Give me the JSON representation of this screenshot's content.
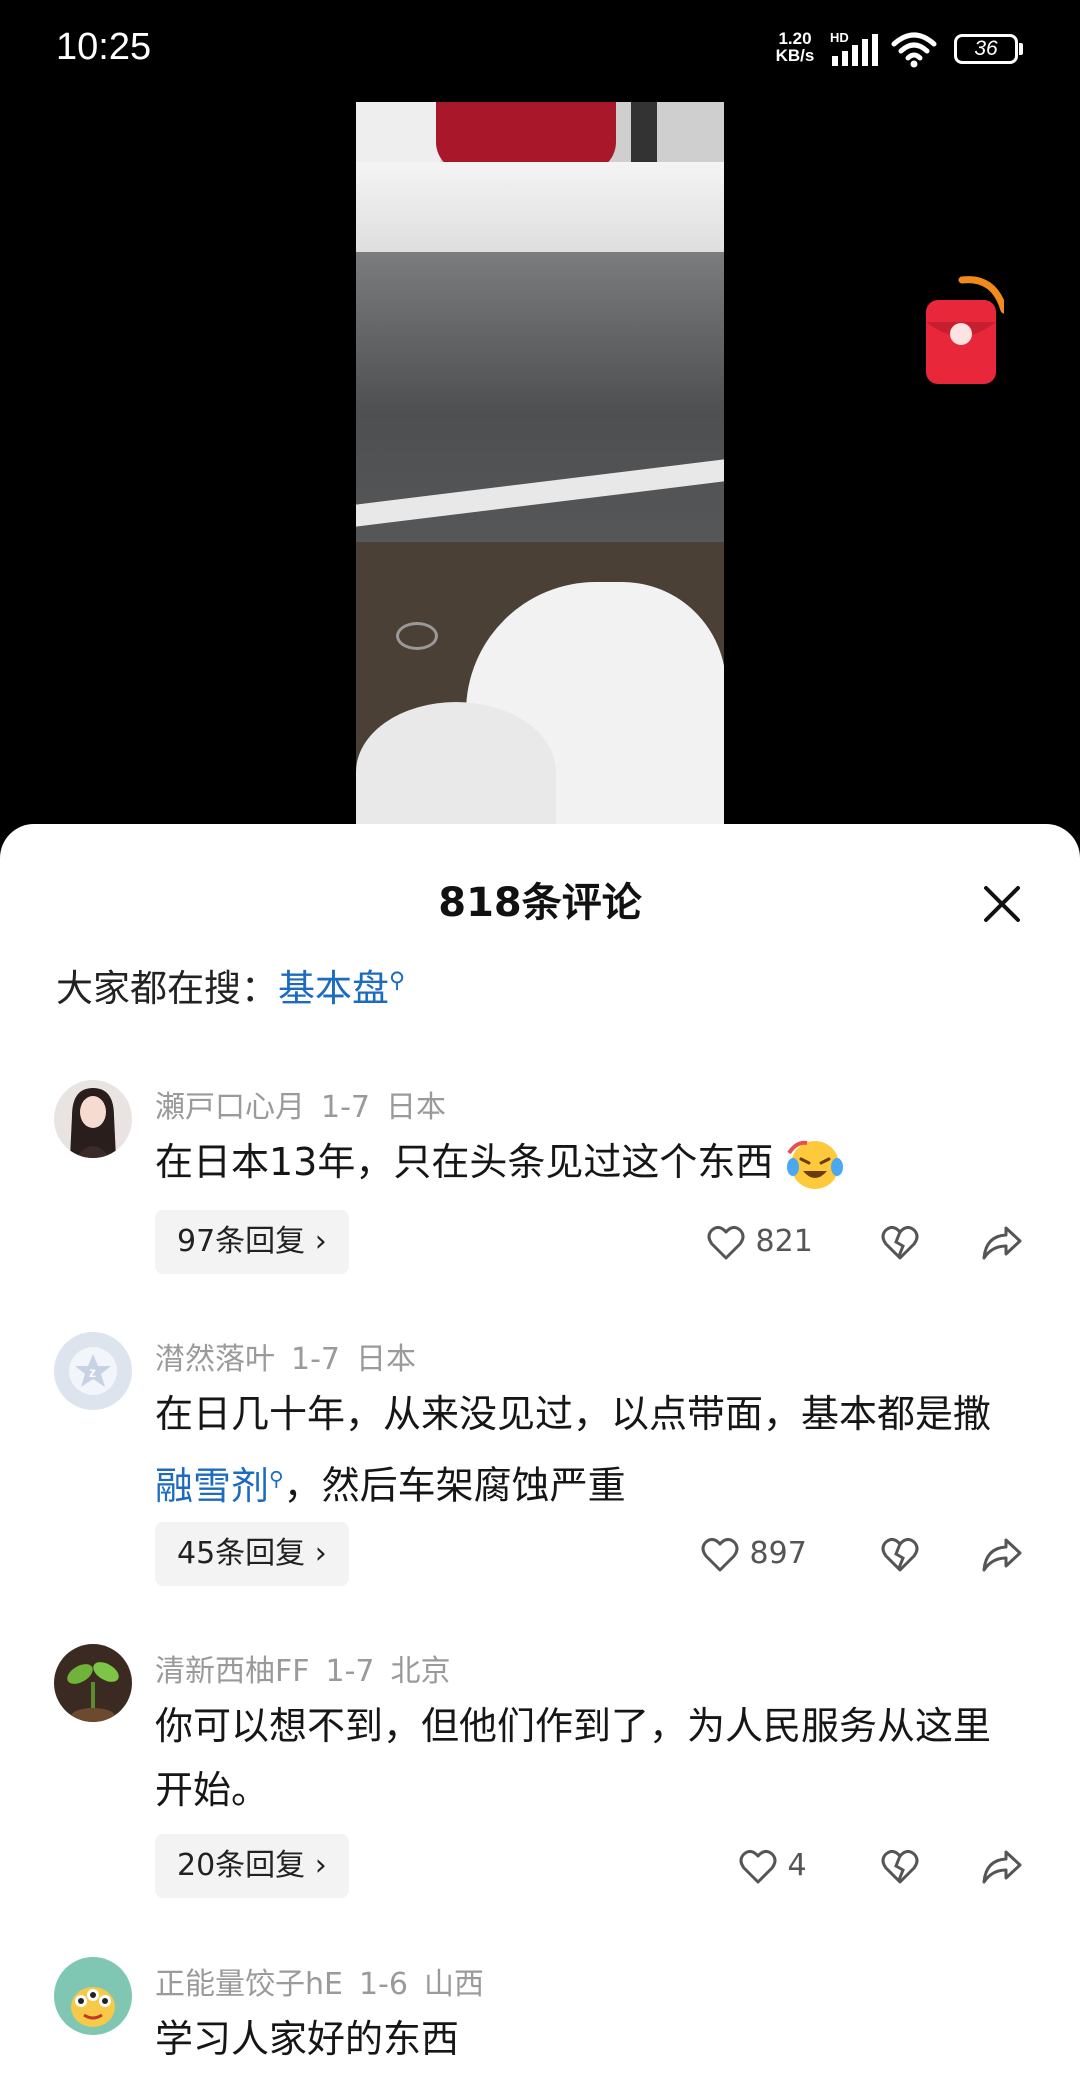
{
  "status_bar": {
    "time": "10:25",
    "net_speed_value": "1.20",
    "net_speed_unit": "KB/s",
    "network_label": "HD",
    "battery": "36"
  },
  "comments_panel": {
    "title": "818条评论",
    "search_prefix": "大家都在搜：",
    "search_keyword": "基本盘"
  },
  "comments": [
    {
      "user": "瀬戸口心月",
      "date": "1-7",
      "location": "日本",
      "text": "在日本13年，只在头条见过这个东西",
      "replies": "97条回复",
      "likes": "821"
    },
    {
      "user": "潸然落叶",
      "date": "1-7",
      "location": "日本",
      "text_before": "在日几十年，从来没见过，以点带面，基本都是撒",
      "keyword": "融雪剂",
      "text_after": "，然后车架腐蚀严重",
      "replies": "45条回复",
      "likes": "897"
    },
    {
      "user": "清新西柚FF",
      "date": "1-7",
      "location": "北京",
      "text": "你可以想不到，但他们作到了，为人民服务从这里开始。",
      "replies": "20条回复",
      "likes": "4"
    },
    {
      "user": "正能量饺子hE",
      "date": "1-6",
      "location": "山西",
      "text": "学习人家好的东西"
    }
  ],
  "colors": {
    "link_blue": "#1d6bbf",
    "meta_gray": "#9a9a9a",
    "reply_bg": "#f3f3f3"
  }
}
